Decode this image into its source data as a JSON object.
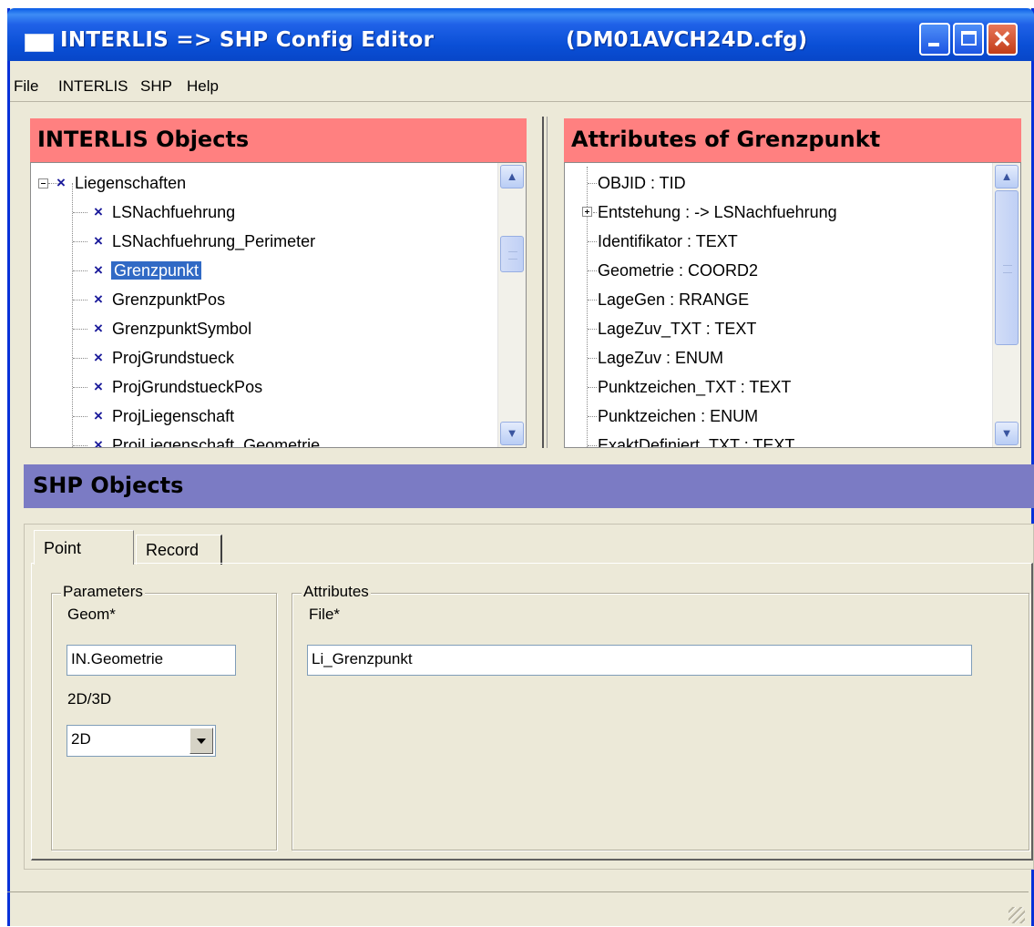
{
  "window": {
    "title": "INTERLIS => SHP Config Editor",
    "file": "(DM01AVCH24D.cfg)",
    "close_glyph": "✕"
  },
  "menu": [
    "File",
    "INTERLIS",
    "SHP",
    "Help"
  ],
  "interlis_panel": {
    "header": "INTERLIS Objects",
    "root": "Liegenschaften",
    "items": [
      "LSNachfuehrung",
      "LSNachfuehrung_Perimeter",
      "Grenzpunkt",
      "GrenzpunktPos",
      "GrenzpunktSymbol",
      "ProjGrundstueck",
      "ProjGrundstueckPos",
      "ProjLiegenschaft",
      "ProjLiegenschaft_Geometrie"
    ],
    "selected": "Grenzpunkt",
    "item_icon": "x-class-icon"
  },
  "attributes_panel": {
    "header": "Attributes of Grenzpunkt",
    "items": [
      "OBJID : TID",
      "Entstehung : -> LSNachfuehrung",
      "Identifikator : TEXT",
      "Geometrie : COORD2",
      "LageGen : RRANGE",
      "LageZuv_TXT : TEXT",
      "LageZuv : ENUM",
      "Punktzeichen_TXT : TEXT",
      "Punktzeichen : ENUM",
      "ExaktDefiniert_TXT : TEXT"
    ],
    "expandable_index": 1
  },
  "shp_panel": {
    "header": "SHP Objects",
    "tabs": [
      "Point",
      "Record"
    ],
    "active_tab": "Point",
    "parameters": {
      "group_label": "Parameters",
      "geom_label": "Geom*",
      "geom_value": "IN.Geometrie",
      "dim_label": "2D/3D",
      "dim_value": "2D"
    },
    "attributes": {
      "group_label": "Attributes",
      "file_label": "File*",
      "file_value": "Li_Grenzpunkt"
    }
  },
  "colors": {
    "interlis_header": "#ff8080",
    "shp_header": "#7b7bc4",
    "selection": "#316ac5",
    "titlebar": "#0a4fd6"
  }
}
